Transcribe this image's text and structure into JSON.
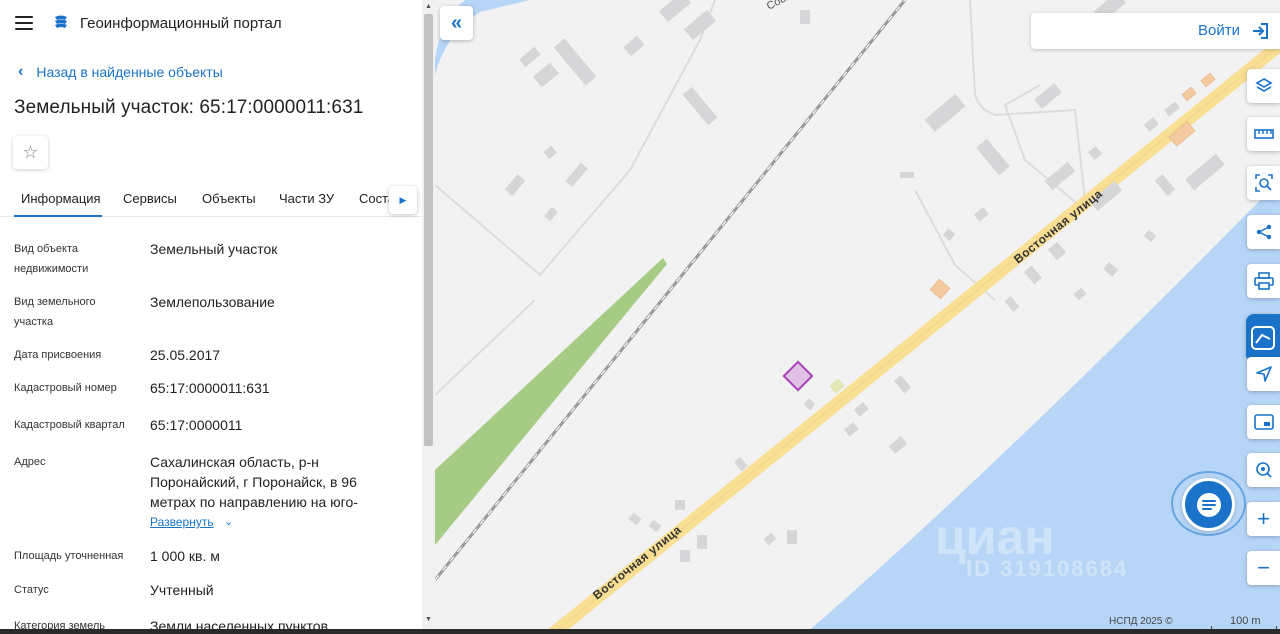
{
  "header": {
    "title": "Геоинформационный портал",
    "menu_icon": "hamburger-icon",
    "logo_icon": "portal-logo-icon"
  },
  "nav": {
    "back_label": "Назад в найденные объекты"
  },
  "object": {
    "title": "Земельный участок: 65:17:0000011:631",
    "favorite_icon": "star-icon"
  },
  "tabs": [
    {
      "label": "Информация",
      "active": true
    },
    {
      "label": "Сервисы"
    },
    {
      "label": "Объекты"
    },
    {
      "label": "Части ЗУ"
    },
    {
      "label": "Соста"
    }
  ],
  "fields": [
    {
      "label": "Вид объекта недвижимости",
      "value": "Земельный участок"
    },
    {
      "label": "Вид земельного участка",
      "value": "Землепользование"
    },
    {
      "label": "Дата присвоения",
      "value": "25.05.2017"
    },
    {
      "label": "Кадастровый номер",
      "value": "65:17:0000011:631"
    },
    {
      "label": "Кадастровый квартал",
      "value": "65:17:0000011"
    },
    {
      "label": "Адрес",
      "value": "Сахалинская область, р-н Поронайский, г Поронайск, в 96 метрах по направлению на юго-"
    },
    {
      "label": "Площадь уточненная",
      "value": "1 000 кв. м"
    },
    {
      "label": "Статус",
      "value": "Учтенный"
    },
    {
      "label": "Категория земель",
      "value": "Земли населенных пунктов"
    }
  ],
  "expand_label": "Развернуть",
  "map": {
    "login_label": "Войти",
    "street_label": "Восточная улица",
    "street_label_top": "Совх",
    "copyright": "НСПД 2025 ©",
    "scale": "100 m",
    "watermark": "циан",
    "watermark_id": "ID 319108684",
    "colors": {
      "water": "#b7d6f7",
      "road": "#f8df94",
      "green": "#a6cb84",
      "parcel": "#a742b5",
      "accent": "#1a73c9"
    },
    "tools": [
      "layers-icon",
      "ruler-icon",
      "search-area-icon",
      "share-icon",
      "print-icon",
      "mark-icon",
      "locate-icon",
      "minimap-icon",
      "geo-search-icon",
      "zoom-in-icon",
      "zoom-out-icon"
    ]
  }
}
